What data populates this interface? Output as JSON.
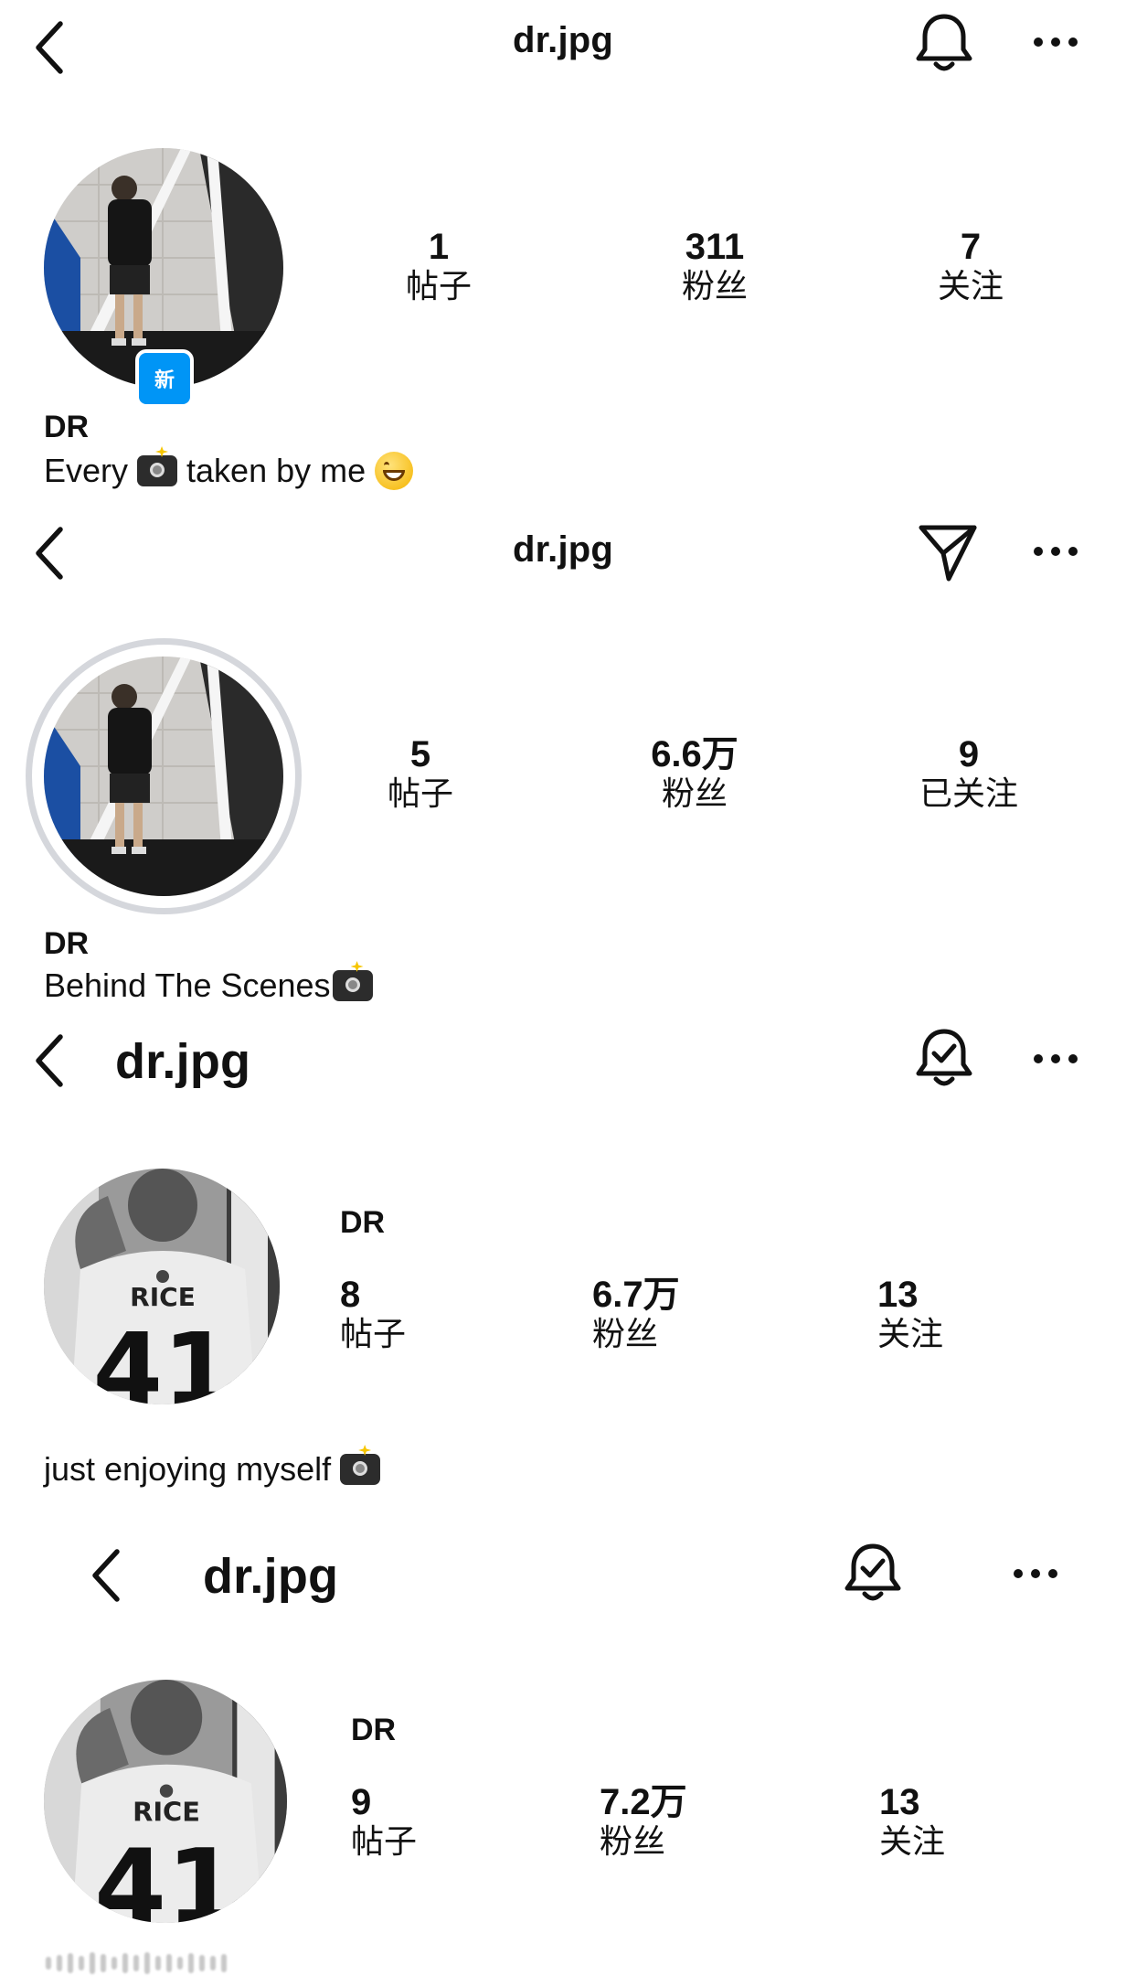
{
  "panels": [
    {
      "title": "dr.jpg",
      "right_icon": "bell-icon",
      "more_icon": "more-icon",
      "avatar_badge": "新",
      "stats": [
        {
          "value": "1",
          "label": "帖子"
        },
        {
          "value": "311",
          "label": "粉丝"
        },
        {
          "value": "7",
          "label": "关注"
        }
      ],
      "display_name": "DR",
      "bio_text_1": "Every",
      "bio_text_2": "taken by me"
    },
    {
      "title": "dr.jpg",
      "right_icon": "send-icon",
      "more_icon": "more-icon",
      "stats": [
        {
          "value": "5",
          "label": "帖子"
        },
        {
          "value": "6.6万",
          "label": "粉丝"
        },
        {
          "value": "9",
          "label": "已关注"
        }
      ],
      "display_name": "DR",
      "bio_text": "Behind The Scenes"
    },
    {
      "title": "dr.jpg",
      "right_icon": "bell-check-icon",
      "more_icon": "more-icon",
      "display_name": "DR",
      "stats": [
        {
          "value": "8",
          "label": "帖子"
        },
        {
          "value": "6.7万",
          "label": "粉丝"
        },
        {
          "value": "13",
          "label": "关注"
        }
      ],
      "bio_text": "just enjoying myself",
      "jersey_name": "RICE",
      "jersey_number": "41"
    },
    {
      "title": "dr.jpg",
      "right_icon": "bell-check-icon",
      "more_icon": "more-icon",
      "display_name": "DR",
      "stats": [
        {
          "value": "9",
          "label": "帖子"
        },
        {
          "value": "7.2万",
          "label": "粉丝"
        },
        {
          "value": "13",
          "label": "关注"
        }
      ],
      "jersey_name": "RICE",
      "jersey_number": "41"
    }
  ],
  "colors": {
    "text": "#111111",
    "badge_blue": "#0095f6",
    "story_ring": "#d5d7dc"
  }
}
